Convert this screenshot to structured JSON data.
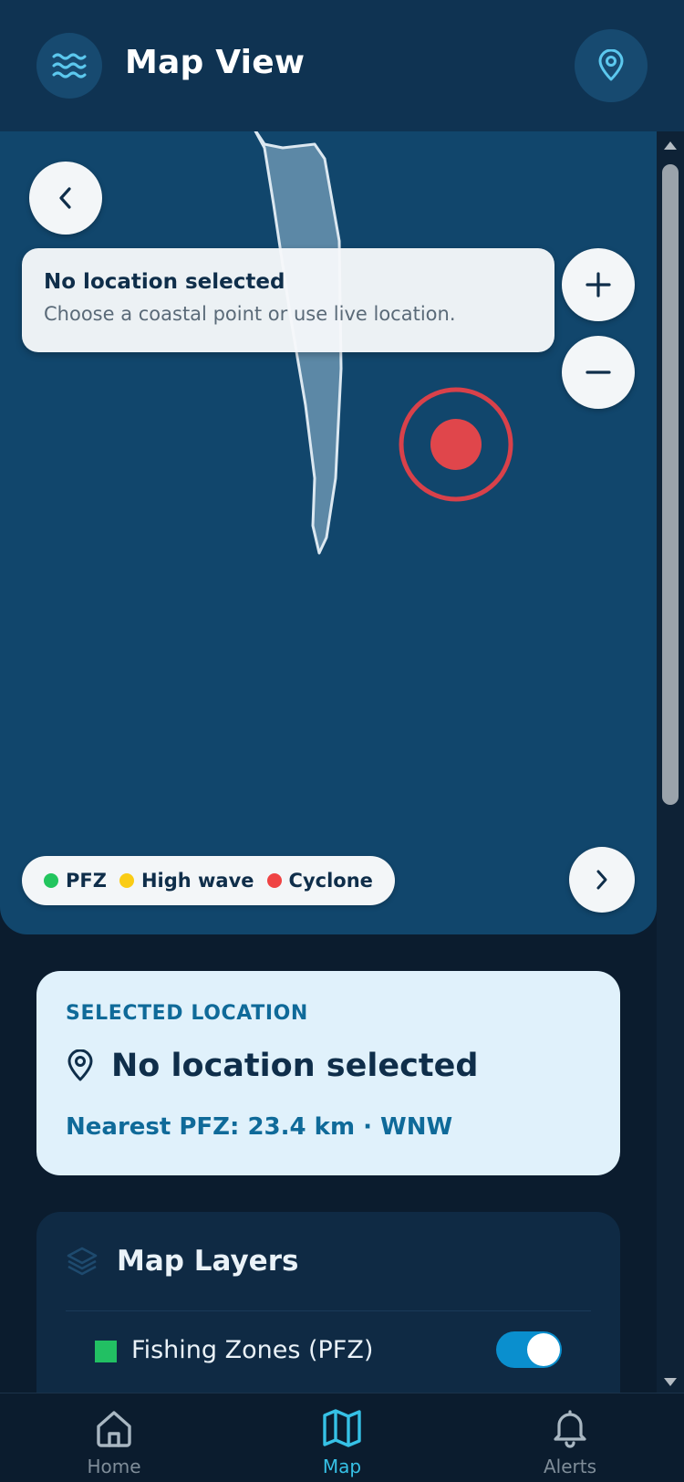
{
  "header": {
    "title": "Map View",
    "app_icon": "waves-icon",
    "location_icon": "map-pin-icon"
  },
  "map": {
    "info_card": {
      "title": "No location selected",
      "subtitle": "Choose a coastal point or use live location."
    },
    "zoom_in_label": "+",
    "zoom_out_label": "−",
    "legend": [
      {
        "label": "PFZ",
        "color": "#22c55e"
      },
      {
        "label": "High wave",
        "color": "#facc15"
      },
      {
        "label": "Cyclone",
        "color": "#ef4444"
      }
    ]
  },
  "selected_location": {
    "label": "SELECTED LOCATION",
    "name": "No location selected",
    "nearest": "Nearest PFZ: 23.4 km · WNW"
  },
  "map_layers": {
    "title": "Map Layers",
    "items": [
      {
        "name": "Fishing Zones (PFZ)",
        "color": "#22c063",
        "enabled": true
      }
    ]
  },
  "nav": {
    "items": [
      {
        "label": "Home",
        "icon": "home-icon",
        "active": false
      },
      {
        "label": "Map",
        "icon": "map-icon",
        "active": true
      },
      {
        "label": "Alerts",
        "icon": "bell-icon",
        "active": false
      }
    ]
  },
  "colors": {
    "header_bg": "#0f3352",
    "map_bg": "#11466c",
    "accent": "#0f6a99",
    "active_nav": "#36c1e6",
    "cyclone": "#ef4444"
  }
}
